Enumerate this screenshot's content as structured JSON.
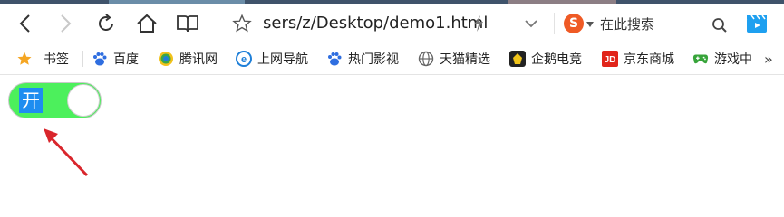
{
  "toolbar": {
    "address": "sers/z/Desktop/demo1.html",
    "search_placeholder": "在此搜索"
  },
  "bookmarks": [
    {
      "label": "书签",
      "icon": "star-icon",
      "color": "#f5a623"
    },
    {
      "label": "百度",
      "icon": "baidu-paw-icon",
      "color": "#2f6ee0"
    },
    {
      "label": "腾讯网",
      "icon": "tencent-icon",
      "color": "#3aa648"
    },
    {
      "label": "上网导航",
      "icon": "ie-e-icon",
      "color": "#1e7fd8"
    },
    {
      "label": "热门影视",
      "icon": "paw-icon",
      "color": "#2f6ee0"
    },
    {
      "label": "天猫精选",
      "icon": "globe-icon",
      "color": "#666666"
    },
    {
      "label": "企鹅电竞",
      "icon": "penguin-icon",
      "color": "#222222"
    },
    {
      "label": "京东商城",
      "icon": "jd-icon",
      "color": "#e1251b"
    },
    {
      "label": "游戏中",
      "icon": "gamepad-icon",
      "color": "#37a43a"
    }
  ],
  "toggle": {
    "label": "开",
    "state": "on",
    "on_color": "#4cf05c",
    "label_highlight": "#1e8df0"
  },
  "annotation": {
    "arrow_color": "#d9262c"
  }
}
